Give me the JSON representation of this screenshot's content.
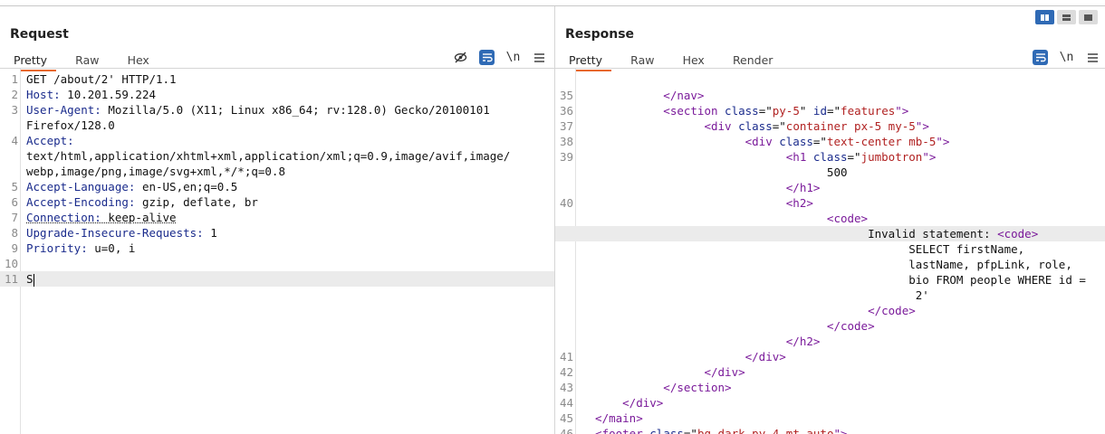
{
  "request": {
    "title": "Request",
    "tabs": [
      "Pretty",
      "Raw",
      "Hex"
    ],
    "toolbar": {
      "eye_off": "⊘",
      "wrap": "≡",
      "newline": "\\n",
      "menu": "≡"
    },
    "lines": [
      {
        "n": "1",
        "parts": [
          {
            "t": "GET /about/2' HTTP/1.1",
            "c": "txt"
          }
        ]
      },
      {
        "n": "2",
        "parts": [
          {
            "t": "Host:",
            "c": "k"
          },
          {
            "t": " 10.201.59.224",
            "c": "txt"
          }
        ]
      },
      {
        "n": "3",
        "parts": [
          {
            "t": "User-Agent:",
            "c": "k"
          },
          {
            "t": " Mozilla/5.0 (X11; Linux x86_64; rv:128.0) Gecko/20100101",
            "c": "txt"
          }
        ]
      },
      {
        "n": "",
        "parts": [
          {
            "t": "Firefox/128.0",
            "c": "txt"
          }
        ]
      },
      {
        "n": "4",
        "parts": [
          {
            "t": "Accept:",
            "c": "k"
          }
        ]
      },
      {
        "n": "",
        "parts": [
          {
            "t": "text/html,application/xhtml+xml,application/xml;q=0.9,image/avif,image/",
            "c": "txt"
          }
        ]
      },
      {
        "n": "",
        "parts": [
          {
            "t": "webp,image/png,image/svg+xml,*/*;q=0.8",
            "c": "txt"
          }
        ]
      },
      {
        "n": "5",
        "parts": [
          {
            "t": "Accept-Language:",
            "c": "k"
          },
          {
            "t": " en-US,en;q=0.5",
            "c": "txt"
          }
        ]
      },
      {
        "n": "6",
        "parts": [
          {
            "t": "Accept-Encoding:",
            "c": "k"
          },
          {
            "t": " gzip, deflate, br",
            "c": "txt"
          }
        ]
      },
      {
        "n": "7",
        "parts": [
          {
            "t": "Connection:",
            "c": "k dotted"
          },
          {
            "t": " keep-alive",
            "c": "txt dotted"
          }
        ]
      },
      {
        "n": "8",
        "parts": [
          {
            "t": "Upgrade-Insecure-Requests:",
            "c": "k"
          },
          {
            "t": " 1",
            "c": "txt"
          }
        ]
      },
      {
        "n": "9",
        "parts": [
          {
            "t": "Priority:",
            "c": "k"
          },
          {
            "t": " u=0, i",
            "c": "txt"
          }
        ]
      },
      {
        "n": "10",
        "parts": []
      },
      {
        "n": "11",
        "parts": [
          {
            "t": "S",
            "c": "txt"
          }
        ],
        "highlight": true,
        "cursor": true
      }
    ]
  },
  "response": {
    "title": "Response",
    "tabs": [
      "Pretty",
      "Raw",
      "Hex",
      "Render"
    ],
    "toolbar": {
      "wrap": "≡",
      "newline": "\\n",
      "menu": "≡"
    },
    "lines": [
      {
        "n": "35",
        "parts": [
          {
            "t": "            </nav>",
            "c": "tag"
          }
        ]
      },
      {
        "n": "36",
        "parts": [
          {
            "t": "            <section ",
            "c": "tag"
          },
          {
            "t": "class",
            "c": "attr"
          },
          {
            "t": "=\"",
            "c": "txt"
          },
          {
            "t": "py-5",
            "c": "val"
          },
          {
            "t": "\" ",
            "c": "txt"
          },
          {
            "t": "id",
            "c": "attr"
          },
          {
            "t": "=\"",
            "c": "txt"
          },
          {
            "t": "features",
            "c": "val"
          },
          {
            "t": "\">",
            "c": "tag"
          }
        ]
      },
      {
        "n": "37",
        "parts": [
          {
            "t": "                  <div ",
            "c": "tag"
          },
          {
            "t": "class",
            "c": "attr"
          },
          {
            "t": "=\"",
            "c": "txt"
          },
          {
            "t": "container px-5 my-5",
            "c": "val"
          },
          {
            "t": "\">",
            "c": "tag"
          }
        ]
      },
      {
        "n": "38",
        "parts": [
          {
            "t": "                        <div ",
            "c": "tag"
          },
          {
            "t": "class",
            "c": "attr"
          },
          {
            "t": "=\"",
            "c": "txt"
          },
          {
            "t": "text-center mb-5",
            "c": "val"
          },
          {
            "t": "\">",
            "c": "tag"
          }
        ]
      },
      {
        "n": "39",
        "parts": [
          {
            "t": "                              <h1 ",
            "c": "tag"
          },
          {
            "t": "class",
            "c": "attr"
          },
          {
            "t": "=\"",
            "c": "txt"
          },
          {
            "t": "jumbotron",
            "c": "val"
          },
          {
            "t": "\">",
            "c": "tag"
          }
        ]
      },
      {
        "n": "",
        "parts": [
          {
            "t": "                                    500",
            "c": "txt"
          }
        ]
      },
      {
        "n": "",
        "parts": [
          {
            "t": "                              </h1>",
            "c": "tag"
          }
        ]
      },
      {
        "n": "40",
        "parts": [
          {
            "t": "                              <h2>",
            "c": "tag"
          }
        ]
      },
      {
        "n": "",
        "parts": [
          {
            "t": "                                    <code>",
            "c": "tag"
          }
        ]
      },
      {
        "n": "",
        "parts": [
          {
            "t": "                                          Invalid statement: ",
            "c": "txt"
          },
          {
            "t": "<code>",
            "c": "tag"
          }
        ],
        "highlight": true
      },
      {
        "n": "",
        "parts": [
          {
            "t": "                                                SELECT firstName,",
            "c": "txt"
          }
        ]
      },
      {
        "n": "",
        "parts": [
          {
            "t": "                                                lastName, pfpLink, role,",
            "c": "txt"
          }
        ]
      },
      {
        "n": "",
        "parts": [
          {
            "t": "                                                bio FROM people WHERE id =",
            "c": "txt"
          }
        ]
      },
      {
        "n": "",
        "parts": [
          {
            "t": "                                                 2'",
            "c": "txt"
          }
        ]
      },
      {
        "n": "",
        "parts": [
          {
            "t": "                                          </code>",
            "c": "tag"
          }
        ]
      },
      {
        "n": "",
        "parts": [
          {
            "t": "                                    </code>",
            "c": "tag"
          }
        ]
      },
      {
        "n": "",
        "parts": [
          {
            "t": "                              </h2>",
            "c": "tag"
          }
        ]
      },
      {
        "n": "41",
        "parts": [
          {
            "t": "                        </div>",
            "c": "tag"
          }
        ]
      },
      {
        "n": "42",
        "parts": [
          {
            "t": "                  </div>",
            "c": "tag"
          }
        ]
      },
      {
        "n": "43",
        "parts": [
          {
            "t": "            </section>",
            "c": "tag"
          }
        ]
      },
      {
        "n": "44",
        "parts": [
          {
            "t": "      </div>",
            "c": "tag"
          }
        ]
      },
      {
        "n": "45",
        "parts": [
          {
            "t": "  </main>",
            "c": "tag"
          }
        ]
      },
      {
        "n": "46",
        "parts": [
          {
            "t": "  <footer ",
            "c": "tag"
          },
          {
            "t": "class",
            "c": "attr"
          },
          {
            "t": "=\"",
            "c": "txt"
          },
          {
            "t": "bg-dark py-4 mt-auto",
            "c": "val"
          },
          {
            "t": "\">",
            "c": "tag"
          }
        ]
      }
    ]
  }
}
